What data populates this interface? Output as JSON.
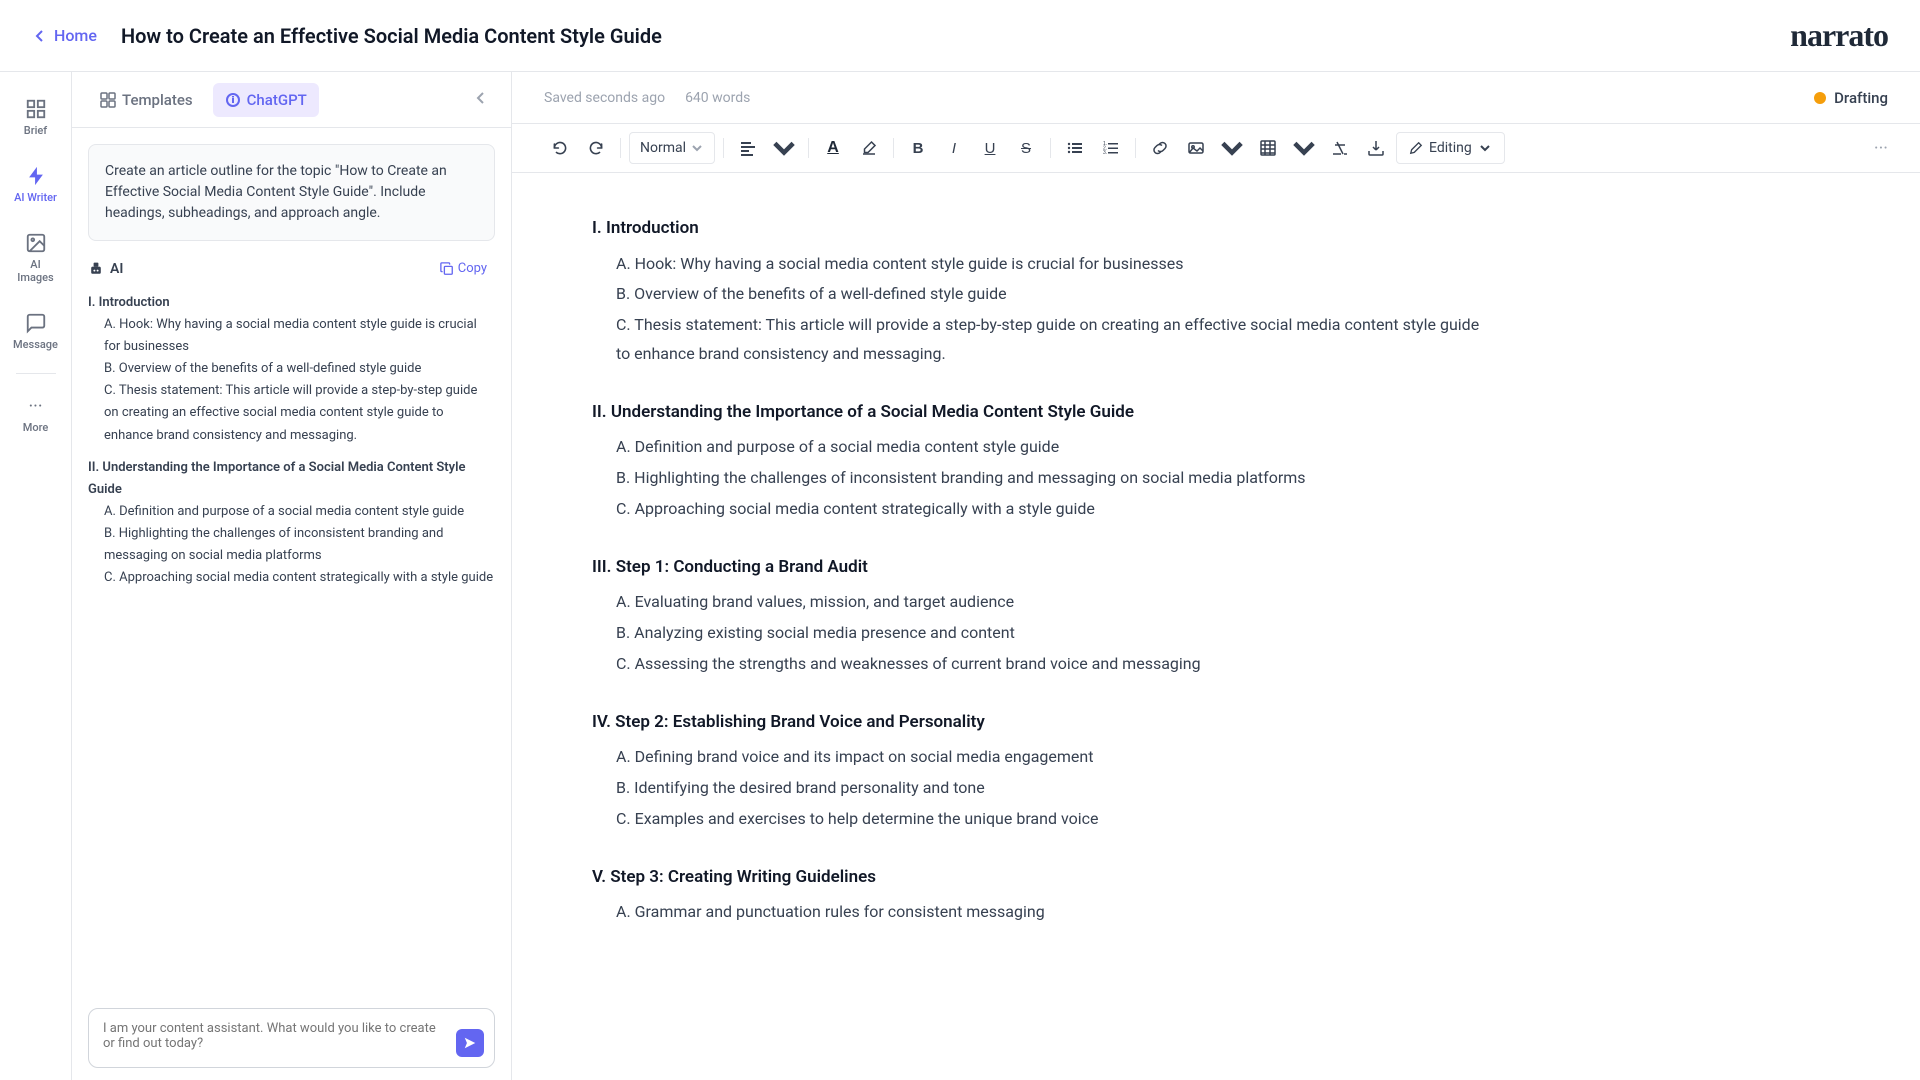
{
  "topbar": {
    "home_label": "Home",
    "doc_title": "How to Create an Effective Social Media Content Style Guide",
    "logo": "narrato"
  },
  "sidebar": {
    "items": [
      {
        "id": "brief",
        "label": "Brief",
        "icon": "grid"
      },
      {
        "id": "ai-writer",
        "label": "AI Writer",
        "icon": "lightning"
      },
      {
        "id": "ai-images",
        "label": "AI Images",
        "icon": "image"
      },
      {
        "id": "message",
        "label": "Message",
        "icon": "chat"
      },
      {
        "id": "more",
        "label": "More",
        "icon": "dots"
      }
    ]
  },
  "panel": {
    "tabs": [
      {
        "id": "templates",
        "label": "Templates",
        "active": false
      },
      {
        "id": "chatgpt",
        "label": "ChatGPT",
        "active": true
      }
    ],
    "prompt_text": "Create an article outline for the topic \"How to Create an Effective Social Media Content Style Guide\". Include headings, subheadings, and approach angle.",
    "ai_label": "AI",
    "copy_label": "Copy",
    "outline": [
      {
        "text": "I. Introduction",
        "level": 0
      },
      {
        "text": "A. Hook: Why having a social media content style guide is crucial for businesses",
        "level": 1
      },
      {
        "text": "B. Overview of the benefits of a well-defined style guide",
        "level": 1
      },
      {
        "text": "C. Thesis statement: This article will provide a step-by-step guide on creating an effective social media content style guide to enhance brand consistency and messaging.",
        "level": 1
      },
      {
        "text": "II. Understanding the Importance of a Social Media Content Style Guide",
        "level": 0
      },
      {
        "text": "A. Definition and purpose of a social media content style guide",
        "level": 1
      },
      {
        "text": "B. Highlighting the challenges of inconsistent branding and messaging on social media platforms",
        "level": 1
      },
      {
        "text": "C. Approaching social media content strategically with a style guide",
        "level": 1
      }
    ],
    "chat_placeholder": "I am your content assistant. What would you like to create or find out today?"
  },
  "editor": {
    "saved_text": "Saved seconds ago",
    "word_count": "640 words",
    "status": "Drafting",
    "toolbar": {
      "undo": "↩",
      "redo": "↪",
      "style": "Normal",
      "bold_label": "B",
      "italic_label": "I",
      "underline_label": "U",
      "strikethrough_label": "S",
      "editing_label": "Editing"
    },
    "content": {
      "sections": [
        {
          "title": "I. Introduction",
          "items": [
            "A. Hook: Why having a social media content style guide is crucial for businesses",
            "B. Overview of the benefits of a well-defined style guide",
            "C. Thesis statement: This article will provide a step-by-step guide on creating an effective social media content style guide to enhance brand consistency and messaging."
          ]
        },
        {
          "title": "II. Understanding the Importance of a Social Media Content Style Guide",
          "items": [
            "A. Definition and purpose of a social media content style guide",
            "B. Highlighting the challenges of inconsistent branding and messaging on social media platforms",
            "C. Approaching social media content strategically with a style guide"
          ]
        },
        {
          "title": "III. Step 1: Conducting a Brand Audit",
          "items": [
            "A. Evaluating brand values, mission, and target audience",
            "B. Analyzing existing social media presence and content",
            "C. Assessing the strengths and weaknesses of current brand voice and messaging"
          ]
        },
        {
          "title": "IV. Step 2: Establishing Brand Voice and Personality",
          "items": [
            "A. Defining brand voice and its impact on social media engagement",
            "B. Identifying the desired brand personality and tone",
            "C. Examples and exercises to help determine the unique brand voice"
          ]
        },
        {
          "title": "V. Step 3: Creating Writing Guidelines",
          "items": [
            "A. Grammar and punctuation rules for consistent messaging"
          ]
        }
      ]
    }
  }
}
